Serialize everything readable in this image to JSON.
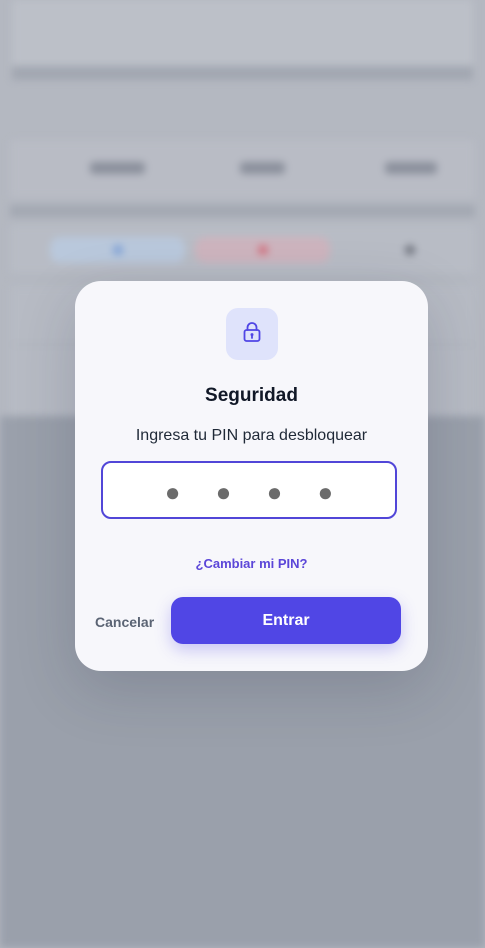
{
  "background": {
    "overlay_color": "#b4b8c1",
    "stats": [
      "",
      "",
      ""
    ],
    "actions": [
      {
        "color": "#b9c8dc",
        "icon_color": "#7fa1d6"
      },
      {
        "color": "#cdb4be",
        "icon_color": "#d1707e"
      },
      {
        "color": "transparent",
        "icon_color": "#6d717b"
      }
    ]
  },
  "modal": {
    "icon": "lock-icon",
    "title": "Seguridad",
    "subtitle": "Ingresa tu PIN para desbloquear",
    "pin_value": "● ● ● ●",
    "pin_length": 4,
    "change_pin_link": "¿Cambiar mi PIN?",
    "cancel_label": "Cancelar",
    "submit_label": "Entrar",
    "accent_color": "#5046e5",
    "icon_tile_color": "#dfe3fb"
  }
}
